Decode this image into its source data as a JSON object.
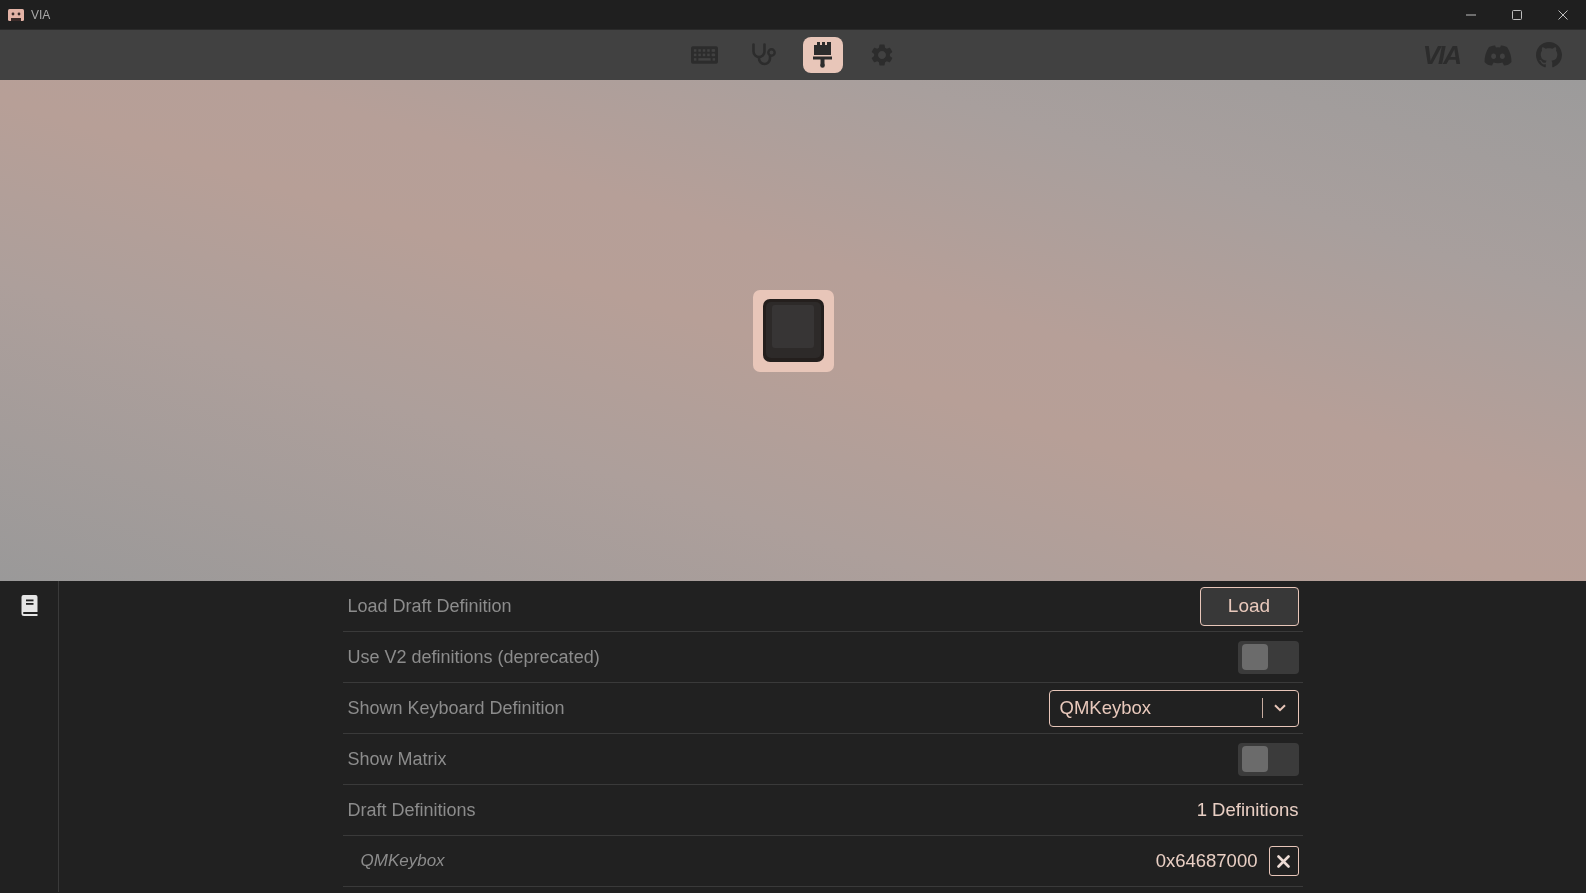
{
  "window": {
    "title": "VIA"
  },
  "nav": {
    "tabs": [
      {
        "kind": "keyboard",
        "selected": false
      },
      {
        "kind": "stethoscope",
        "selected": false
      },
      {
        "kind": "brush",
        "selected": true
      },
      {
        "kind": "gear",
        "selected": false
      }
    ],
    "logo": "VIA",
    "links": [
      {
        "kind": "discord"
      },
      {
        "kind": "github"
      }
    ]
  },
  "sidebar": {
    "items": [
      {
        "kind": "book",
        "selected": true
      }
    ]
  },
  "settings": {
    "rows": [
      {
        "kind": "button",
        "label": "Load Draft Definition",
        "button": "Load"
      },
      {
        "kind": "toggle",
        "label": "Use V2 definitions (deprecated)",
        "on": false
      },
      {
        "kind": "select",
        "label": "Shown Keyboard Definition",
        "value": "QMKeybox"
      },
      {
        "kind": "toggle",
        "label": "Show Matrix",
        "on": false
      },
      {
        "kind": "count",
        "label": "Draft Definitions",
        "value": "1 Definitions"
      },
      {
        "kind": "definition",
        "label": "QMKeybox",
        "value": "0x64687000"
      }
    ]
  }
}
